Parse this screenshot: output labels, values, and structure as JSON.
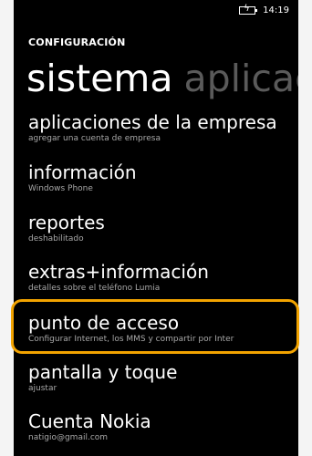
{
  "status": {
    "time": "14:19",
    "battery_icon": "battery-charging-icon"
  },
  "pivot": {
    "title": "CONFIGURACIÓN",
    "active_header": "sistema",
    "next_header": "aplicac"
  },
  "items": [
    {
      "title": "aplicaciones de la empresa",
      "subtitle": "agregar una cuenta de empresa"
    },
    {
      "title": "información",
      "subtitle": "Windows Phone"
    },
    {
      "title": "reportes",
      "subtitle": "deshabilitado"
    },
    {
      "title": "extras+información",
      "subtitle": "detalles sobre el teléfono Lumia"
    },
    {
      "title": "punto de acceso",
      "subtitle": "Configurar Internet, los MMS y compartir por Inter"
    },
    {
      "title": "pantalla y toque",
      "subtitle": "ajustar"
    },
    {
      "title": "Cuenta Nokia",
      "subtitle": "natigio@gmail.com"
    }
  ],
  "highlight_color": "#f2a300"
}
